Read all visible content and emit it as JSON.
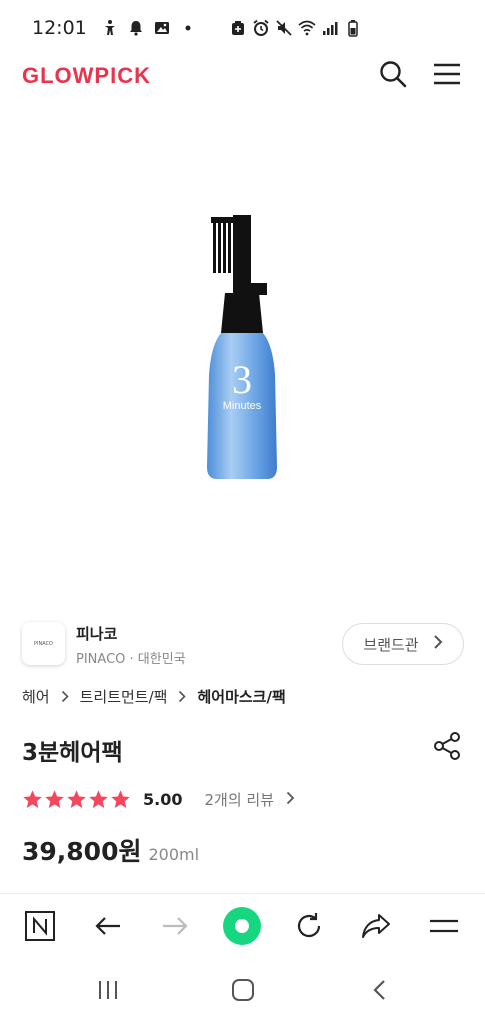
{
  "status_bar": {
    "time": "12:01",
    "icons_left": [
      "accessibility-icon",
      "notification-bell-icon",
      "gallery-icon",
      "dot-icon"
    ],
    "icons_right": [
      "battery-saver-icon",
      "alarm-icon",
      "mute-icon",
      "wifi-icon",
      "signal-icon",
      "battery-icon"
    ]
  },
  "header": {
    "logo": "GLOWPICK",
    "search_icon": "search-icon",
    "menu_icon": "hamburger-menu-icon"
  },
  "product_image": {
    "label_big": "3",
    "label_small": "Minutes"
  },
  "brand": {
    "logo_text": "PINACO",
    "name": "피나코",
    "sub": "PINACO · 대한민국",
    "button_label": "브랜드관"
  },
  "breadcrumb": [
    "헤어",
    "트리트먼트/팩",
    "헤어마스크/팩"
  ],
  "product": {
    "title": "3분헤어팩",
    "rating": 5.0,
    "rating_label": "5.00",
    "review_link": "2개의 리뷰",
    "price": "39,800원",
    "volume": "200ml"
  },
  "colors": {
    "brand": "#e8344e",
    "star": "#f2475d",
    "browser_accent": "#16d67f"
  },
  "browser_toolbar": [
    "naver-icon",
    "back-arrow-icon",
    "forward-arrow-icon",
    "green-dot-icon",
    "refresh-icon",
    "share-arrow-icon",
    "menu-icon"
  ],
  "nav_bar": [
    "recent-apps-icon",
    "home-icon",
    "back-icon"
  ]
}
